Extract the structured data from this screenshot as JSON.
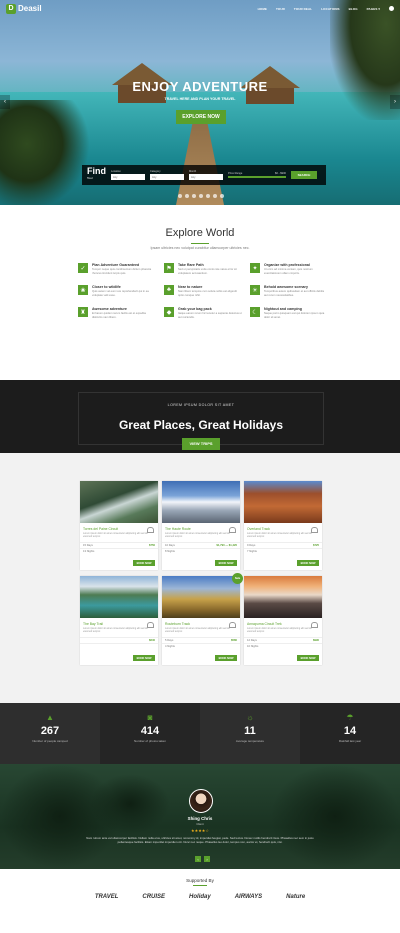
{
  "nav": {
    "logo": "Deasil",
    "logo_mark": "D",
    "items": [
      "HOME",
      "TOUR",
      "TOUR DEAL",
      "LOCATIONS",
      "BLOG",
      "PAGES ▾"
    ]
  },
  "hero": {
    "title": "ENJOY ADVENTURE",
    "subtitle": "TRAVEL HERE AND PLAN YOUR TRAVEL",
    "button": "EXPLORE NOW",
    "prev": "‹",
    "next": "›"
  },
  "find": {
    "title": "Find",
    "subtitle": "Tour",
    "fields": [
      {
        "label": "Location",
        "value": "Any"
      },
      {
        "label": "Category",
        "value": "Any"
      },
      {
        "label": "Month",
        "value": "Any"
      }
    ],
    "range_label": "Price Range",
    "range_min": "$0",
    "range_max": "$900",
    "button": "SEARCH"
  },
  "explore": {
    "title": "Explore World",
    "subtitle": "Ipsam ultricies nec volutpat curabitur ullamcorper ultricies nec.",
    "features": [
      {
        "title": "Plan Adventure Guaranteed",
        "text": "Tempor neque quis condimentum dictum pharetra rhoncus tincidunt turpis quis.",
        "icon": "✓"
      },
      {
        "title": "Take Rare Path",
        "text": "Sed ut perspiciatis unde omnis iste natus error sit voluptatem accusantium.",
        "icon": "⚑"
      },
      {
        "title": "Organize with professional",
        "text": "Ut enim ad minima veniam, quis nostrum exercitationem ullam corporis.",
        "icon": "✦"
      },
      {
        "title": "Closer to wildlife",
        "text": "Quis autem vel eum iure reprehenderit qui in ea voluptate velit esse.",
        "icon": "❀"
      },
      {
        "title": "Near to nature",
        "text": "Nam libero tempore cum soluta nobis est eligendi optio cumque nihil.",
        "icon": "♣"
      },
      {
        "title": "Behold awesome scenary",
        "text": "Temporibus autem quibusdam et aut officiis debitis aut rerum necessitatibus.",
        "icon": "☀"
      },
      {
        "title": "Awesome adventure",
        "text": "Et harum quidem rerum facilis est et expedita distinctio nam libero.",
        "icon": "♜"
      },
      {
        "title": "Grab your bag pack",
        "text": "Itaque earum rerum hic tenetur a sapiente delectus ut aut reiciendis.",
        "icon": "◆"
      },
      {
        "title": "Nightout and camping",
        "text": "Neque porro quisquam est qui dolorem ipsum quia dolor sit amet.",
        "icon": "☾"
      }
    ]
  },
  "banner": {
    "kicker": "LOREM IPSUM DOLOR SIT AMET",
    "title": "Great Places, Great Holidays",
    "button": "VIEW TRIPS"
  },
  "trips": [
    {
      "name": "Torres del Paine Circuit",
      "desc": "Lorem ipsum dolor sit amet consectetur adipiscing elit sed do eiusmod tempor.",
      "days": "15 Days",
      "price": "$750",
      "nights": "13 Nights",
      "button": "BOOK NOW",
      "img": "linear-gradient(160deg,#5d7356,#2f4a35 40%,#c9d6d4 55%,#587a5a 75%,#3b5235)",
      "badge": ""
    },
    {
      "name": "The Haute Route",
      "desc": "Lorem ipsum dolor sit amet consectetur adipiscing elit sed do eiusmod tempor.",
      "days": "10 Days",
      "price": "$1,790 — $1,420",
      "nights": "8 Nights",
      "button": "BOOK NOW",
      "img": "linear-gradient(180deg,#3f6fb5 0%,#7aa3d8 35%,#f2f5fa 50%,#9aa7b7 70%,#5a6573)",
      "badge": ""
    },
    {
      "name": "Overland Track",
      "desc": "Lorem ipsum dolor sit amet consectetur adipiscing elit sed do eiusmod tempor.",
      "days": "9 Days",
      "price": "$725",
      "nights": "7 Nights",
      "button": "BOOK NOW",
      "img": "linear-gradient(180deg,#5b8bcf 0%,#9c4f2c 30%,#c26a35 60%,#7a3a1c)",
      "badge": ""
    },
    {
      "name": "The Bay Trail",
      "desc": "Lorem ipsum dolor sit amet consectetur adipiscing elit sed do eiusmod tempor.",
      "days": "",
      "price": "$640",
      "nights": "",
      "button": "BOOK NOW",
      "img": "linear-gradient(180deg,#8fb4d8 0%,#d9e3ea 25%,#4d7b52 45%,#3c9a9e 70%,#2d5e3a)",
      "badge": ""
    },
    {
      "name": "Routeburn Track",
      "desc": "Lorem ipsum dolor sit amet consectetur adipiscing elit sed do eiusmod tempor.",
      "days": "5 Days",
      "price": "$580",
      "nights": "4 Nights",
      "button": "BOOK NOW",
      "img": "linear-gradient(180deg,#4a7bc4 0%,#9db6d6 30%,#c7a24a 55%,#8a6a2c 80%,#4e3f1c)",
      "badge": "Sale"
    },
    {
      "name": "Annapurna Circuit Trek",
      "desc": "Lorem ipsum dolor sit amet consectetur adipiscing elit sed do eiusmod tempor.",
      "days": "12 Days",
      "price": "$990",
      "nights": "10 Nights",
      "button": "BOOK NOW",
      "img": "linear-gradient(180deg,#d97a3c 0%,#f0b27a 25%,#e9d8c8 45%,#5a4a45 65%,#2a2222)",
      "badge": ""
    }
  ],
  "stats": [
    {
      "num": "267",
      "label": "Number of people camped",
      "icon": "▲",
      "bg": "#2e2e2e"
    },
    {
      "num": "414",
      "label": "Number of photos taken",
      "icon": "◙",
      "bg": "#252525"
    },
    {
      "num": "11",
      "label": "Average temperature",
      "icon": "☼",
      "bg": "#2e2e2e"
    },
    {
      "num": "14",
      "label": "Rainfall last year",
      "icon": "☂",
      "bg": "#252525"
    }
  ],
  "testimonial": {
    "name": "Shing Chris",
    "role": "Client",
    "stars": "★★★★☆",
    "text": "Nam rutrum ante vel ullamcorper facilisis. Nullam nulla eros, ultricies sit amet, nonummy id, imperdiet feugiat, pede. Sed lectus. Donec mollis hendrerit risus. Phasellus nec sem in justo pellentesque facilisis. Etiam imperdiet imperdiet orci. Nunc nec neque. Phasellus leo dolor, tempus non, auctor et, hendrerit quis, nisi.",
    "prev": "‹",
    "next": "›"
  },
  "sponsors": {
    "title": "Supported By",
    "logos": [
      "TRAVEL",
      "CRUISE",
      "Holiday",
      "AIRWAYS",
      "Nature"
    ]
  }
}
